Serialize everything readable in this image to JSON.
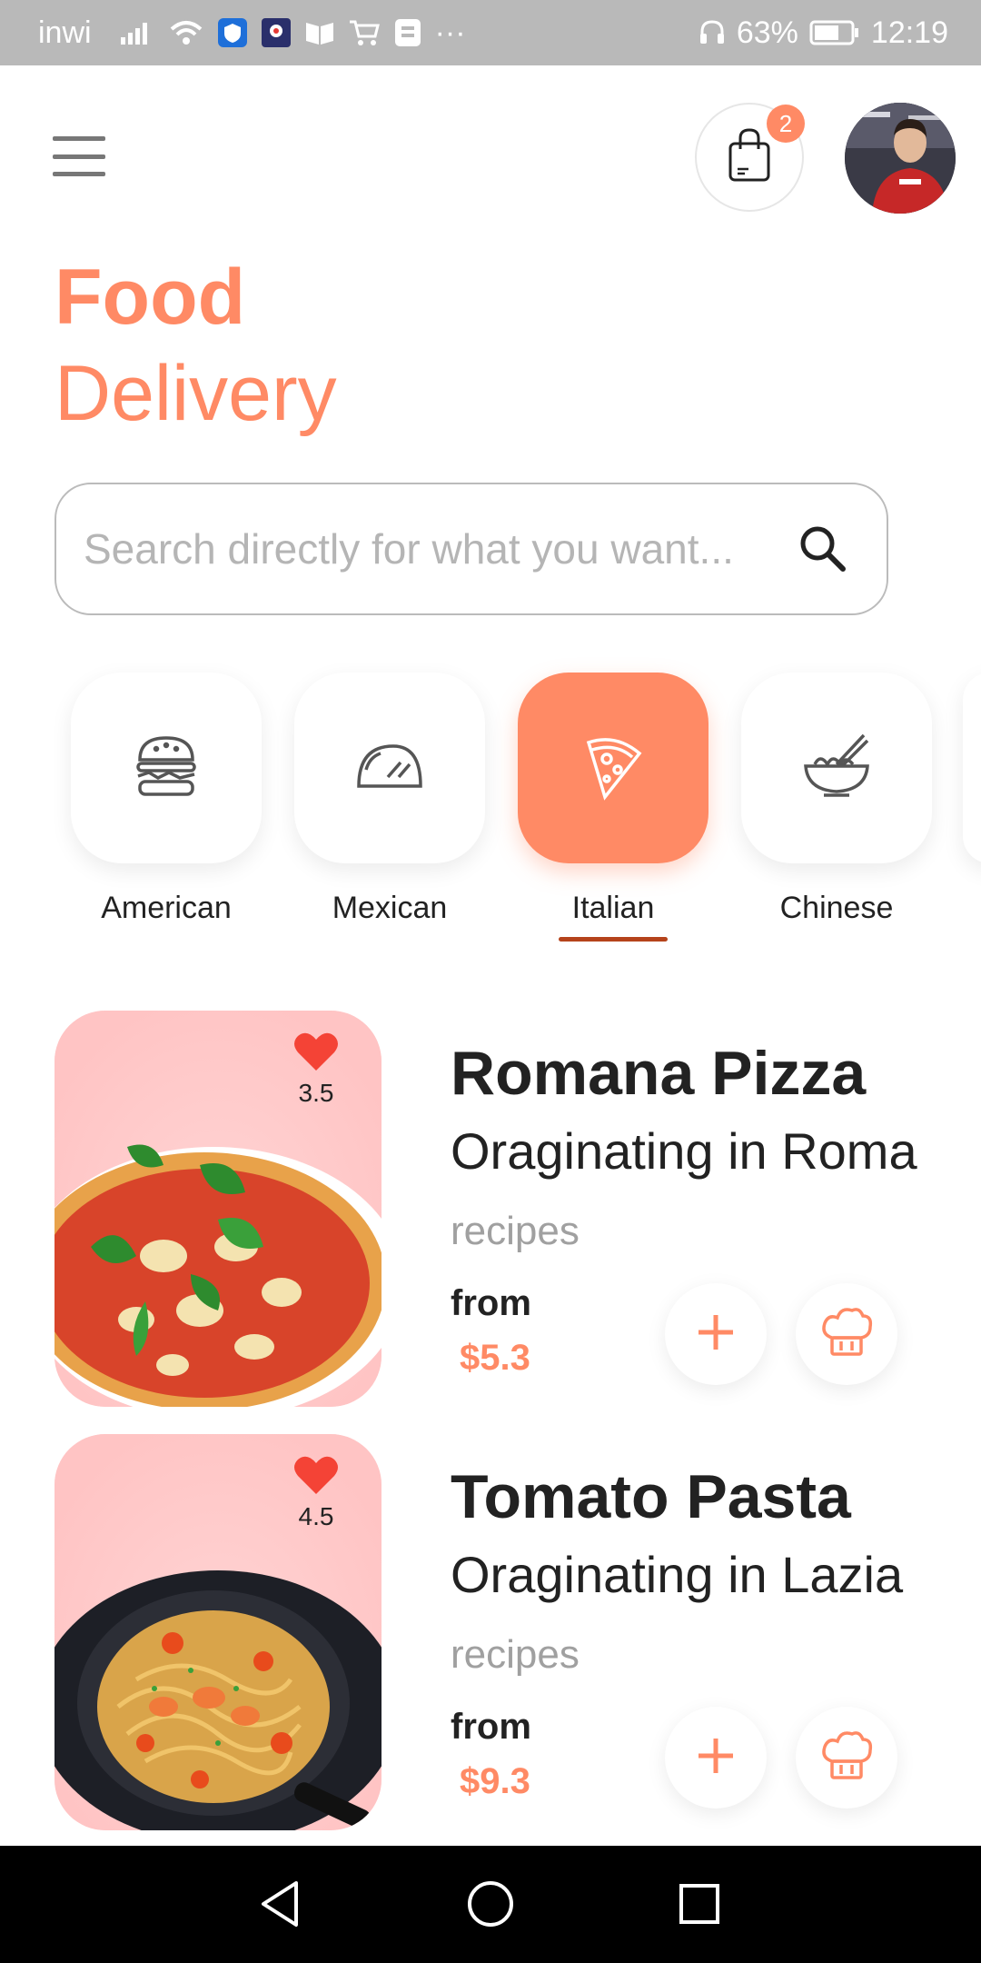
{
  "status_bar": {
    "carrier": "inwi",
    "more_indicator": "···",
    "battery_percent": "63%",
    "time": "12:19",
    "icons": [
      "signal-icon",
      "wifi-icon",
      "shield-icon",
      "app-icon",
      "book-icon",
      "cart-app-icon",
      "file-icon",
      "headset-icon",
      "battery-icon"
    ]
  },
  "header": {
    "menu_icon": "menu-icon",
    "cart_icon": "shopping-bag-icon",
    "cart_count": "2"
  },
  "title": {
    "line1": "Food",
    "line2": "Delivery"
  },
  "search": {
    "placeholder": "Search directly for what you want...",
    "value": ""
  },
  "categories": [
    {
      "label": "American",
      "icon": "burger-icon",
      "active": false
    },
    {
      "label": "Mexican",
      "icon": "taco-icon",
      "active": false
    },
    {
      "label": "Italian",
      "icon": "pizza-icon",
      "active": true
    },
    {
      "label": "Chinese",
      "icon": "noodles-icon",
      "active": false
    }
  ],
  "foods": [
    {
      "name": "Romana Pizza",
      "origin": "Oraginating in Roma",
      "tag": "recipes",
      "from_label": "from",
      "price": "$5.3",
      "rating": "3.5"
    },
    {
      "name": "Tomato Pasta",
      "origin": "Oraginating in Lazia",
      "tag": "recipes",
      "from_label": "from",
      "price": "$9.3",
      "rating": "4.5"
    }
  ],
  "colors": {
    "accent": "#ff8a65",
    "underline": "#b5431b",
    "card_bg": "#ffd4d4",
    "heart": "#f44336",
    "status_bar": "#b9b9b9"
  },
  "nav": {
    "icons": [
      "back-icon",
      "home-icon",
      "recents-icon"
    ]
  }
}
